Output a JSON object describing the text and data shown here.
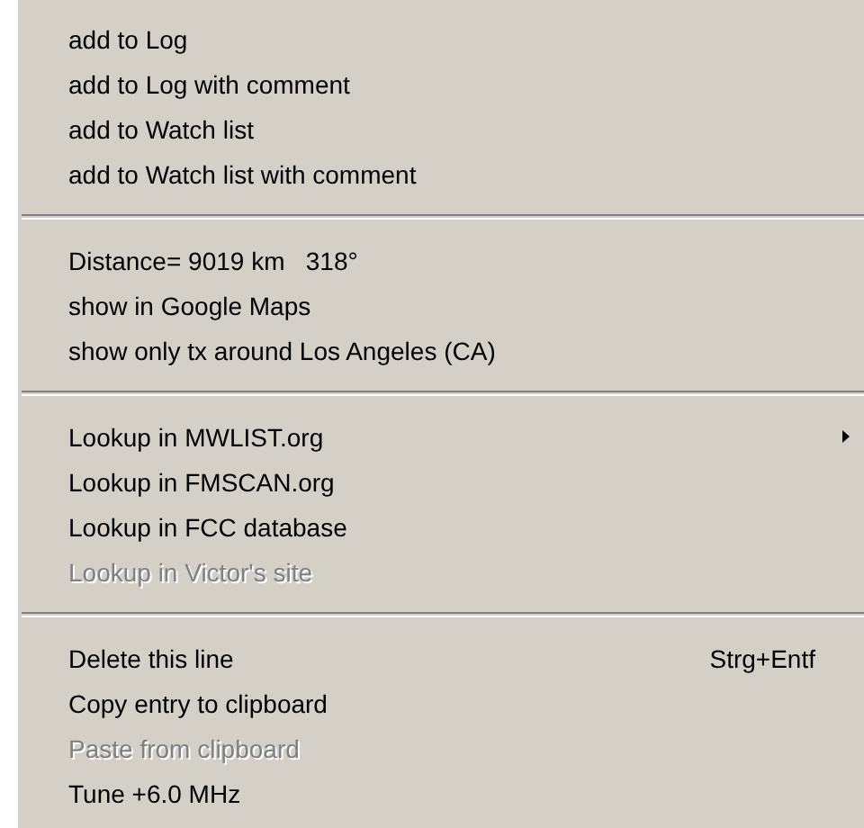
{
  "context_menu": {
    "sections": [
      {
        "items": [
          {
            "label": "add to Log",
            "disabled": false
          },
          {
            "label": "add to Log with comment",
            "disabled": false
          },
          {
            "label": "add to Watch list",
            "disabled": false
          },
          {
            "label": "add to Watch list with comment",
            "disabled": false
          }
        ]
      },
      {
        "items": [
          {
            "label": "Distance= 9019 km   318°",
            "disabled": false
          },
          {
            "label": "show in Google Maps",
            "disabled": false
          },
          {
            "label": "show only tx around Los Angeles (CA)",
            "disabled": false
          }
        ]
      },
      {
        "items": [
          {
            "label": "Lookup in MWLIST.org",
            "disabled": false,
            "submenu": true
          },
          {
            "label": "Lookup in FMSCAN.org",
            "disabled": false
          },
          {
            "label": "Lookup in FCC database",
            "disabled": false
          },
          {
            "label": "Lookup in Victor's site",
            "disabled": true
          }
        ]
      },
      {
        "items": [
          {
            "label": "Delete this line",
            "disabled": false,
            "shortcut": "Strg+Entf"
          },
          {
            "label": "Copy entry to clipboard",
            "disabled": false
          },
          {
            "label": "Paste from clipboard",
            "disabled": true
          },
          {
            "label": "Tune +6.0 MHz",
            "disabled": false
          }
        ]
      }
    ]
  }
}
